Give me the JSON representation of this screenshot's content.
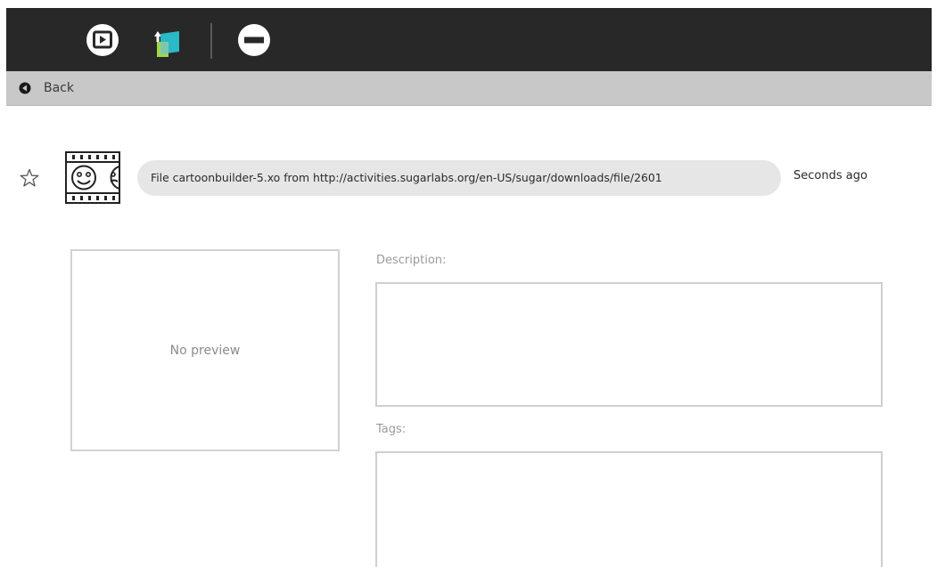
{
  "toolbar": {
    "buttons": [
      {
        "icon": "play-activity-icon"
      },
      {
        "icon": "copy-to-icon"
      },
      {
        "icon": "erase-icon"
      }
    ]
  },
  "backbar": {
    "back_label": "Back",
    "icon": "back-arrow-icon"
  },
  "entry": {
    "favorite_icon": "star-icon",
    "activity_icon": "cartoon-builder-icon",
    "title": "File cartoonbuilder-5.xo from http://activities.sugarlabs.org/en-US/sugar/downloads/file/2601",
    "date": "Seconds ago"
  },
  "preview": {
    "text": "No preview"
  },
  "description": {
    "label": "Description:",
    "value": ""
  },
  "tags": {
    "label": "Tags:",
    "value": ""
  }
}
